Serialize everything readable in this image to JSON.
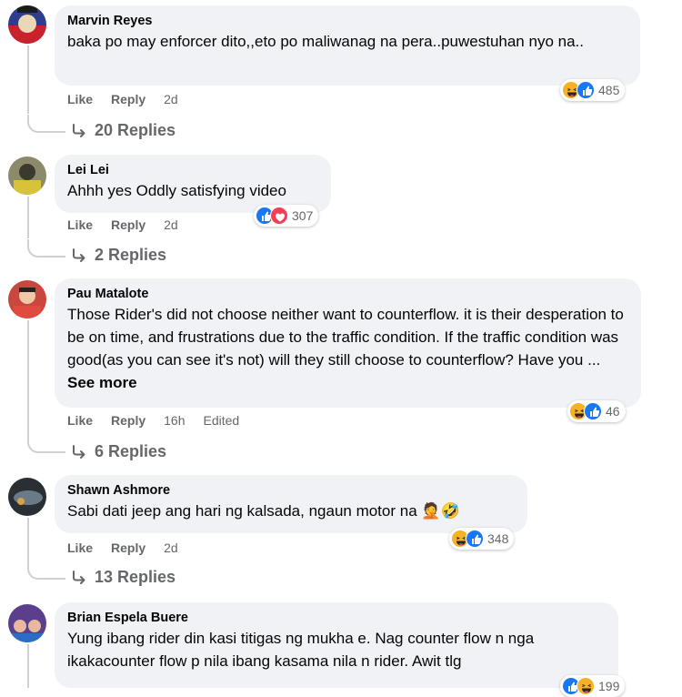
{
  "comments": [
    {
      "author": "Marvin Reyes",
      "text": "baka po may enforcer dito,,eto po maliwanag na pera..puwestuhan nyo na..",
      "like": "Like",
      "reply": "Reply",
      "time": "2d",
      "reactions": [
        "haha-icon",
        "like-icon"
      ],
      "react_count": "485",
      "replies": "20 Replies"
    },
    {
      "author": "Lei Lei",
      "text": "Ahhh yes Oddly satisfying video",
      "like": "Like",
      "reply": "Reply",
      "time": "2d",
      "reactions": [
        "like-icon",
        "love-icon"
      ],
      "react_count": "307",
      "replies": "2 Replies"
    },
    {
      "author": "Pau Matalote",
      "text": "Those Rider's did not choose neither want to counterflow. it is their desperation to be on time, and frustrations due to the traffic condition. If the traffic condition was good(as you can see it's not) will they still choose to counterflow? Have you ...",
      "see_more": "See more",
      "like": "Like",
      "reply": "Reply",
      "time": "16h",
      "edited": "Edited",
      "reactions": [
        "haha-icon",
        "like-icon"
      ],
      "react_count": "46",
      "replies": "6 Replies"
    },
    {
      "author": "Shawn Ashmore",
      "text": "Sabi dati jeep ang hari ng kalsada, ngaun motor na",
      "emoji_suffix": "🤦🤣",
      "like": "Like",
      "reply": "Reply",
      "time": "2d",
      "reactions": [
        "haha-icon",
        "like-icon"
      ],
      "react_count": "348",
      "replies": "13 Replies"
    },
    {
      "author": "Brian Espela Buere",
      "text": "Yung ibang rider din kasi titigas ng mukha e. Nag counter flow n nga ikakacounter flow p nila ibang kasama nila n rider. Awit tlg",
      "reactions": [
        "like-icon",
        "haha-icon"
      ],
      "react_count": "199"
    }
  ],
  "colors": {
    "bubble": "#f0f2f5",
    "meta": "#65676b",
    "like_blue": "#1877f2",
    "love_red": "#f33e58",
    "haha_yellow": "#f7b125"
  }
}
